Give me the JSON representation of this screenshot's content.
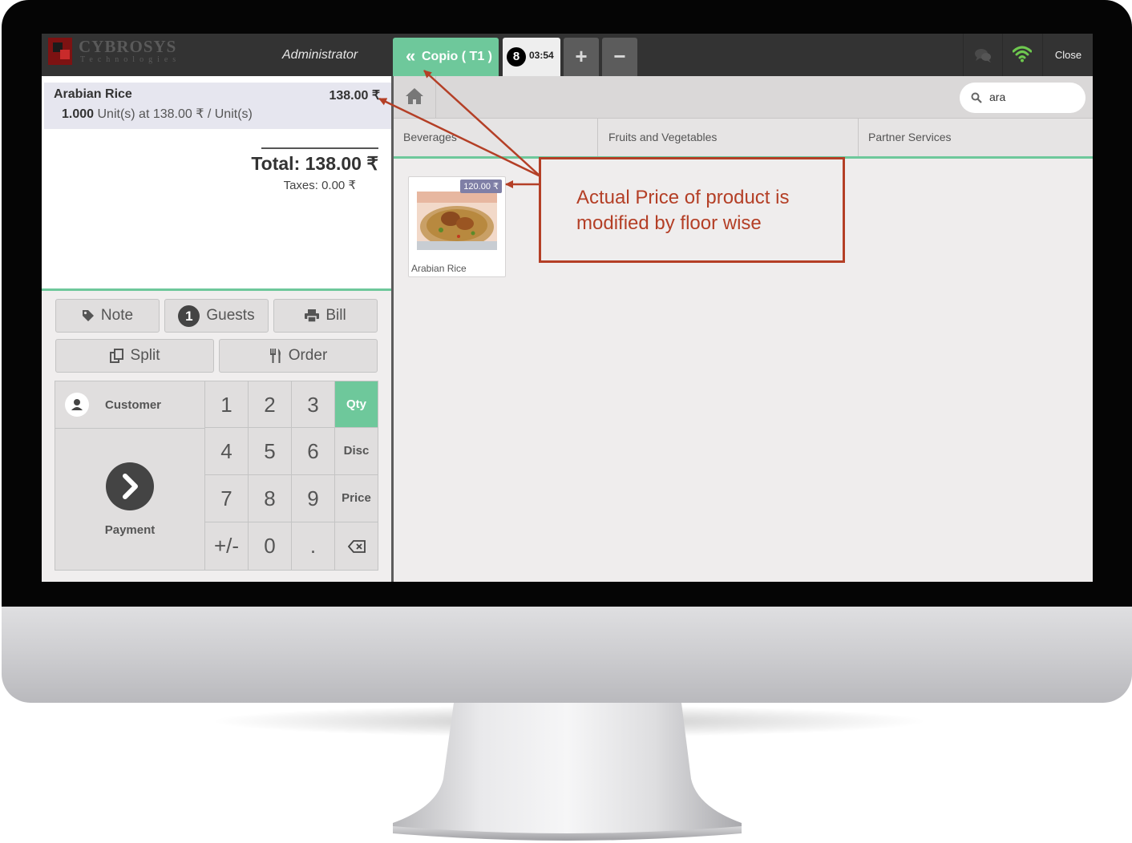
{
  "header": {
    "logo_text": "CYBROSYS",
    "logo_subtext": "Technologies",
    "user_name": "Administrator",
    "floor_button_label": "Copio ( T1 )",
    "order_tab_number": "8",
    "order_tab_time": "03:54",
    "add_order_label": "+",
    "remove_order_label": "−",
    "chat_icon": "chat-bubbles-icon",
    "wifi_icon": "wifi-icon",
    "wifi_color": "#6ec84f",
    "close_label": "Close"
  },
  "order": {
    "lines": [
      {
        "product": "Arabian Rice",
        "price": "138.00 ₹",
        "quantity": "1.000",
        "detail": " Unit(s) at 138.00 ₹ / Unit(s)"
      }
    ],
    "total": "Total: 138.00 ₹",
    "taxes": "Taxes: 0.00 ₹"
  },
  "actions": {
    "note_label": "Note",
    "guests_count": "1",
    "guests_label": "Guests",
    "bill_label": "Bill",
    "split_label": "Split",
    "order_label": "Order"
  },
  "numpad": {
    "customer_label": "Customer",
    "payment_label": "Payment",
    "keys": [
      "1",
      "2",
      "3",
      "4",
      "5",
      "6",
      "7",
      "8",
      "9",
      "+/-",
      "0",
      "."
    ],
    "modes": [
      "Qty",
      "Disc",
      "Price"
    ],
    "active_mode": "Qty"
  },
  "products": {
    "search_value": "ara",
    "categories": [
      "Beverages",
      "Fruits and Vegetables",
      "Partner Services"
    ],
    "items": [
      {
        "name": "Arabian Rice",
        "price_tag": "120.00 ₹"
      }
    ]
  },
  "annotation": {
    "text": "Actual Price of product is modified by floor wise",
    "color": "#b43f26"
  },
  "theme": {
    "accent": "#6ec89b",
    "topbar": "#333333"
  }
}
